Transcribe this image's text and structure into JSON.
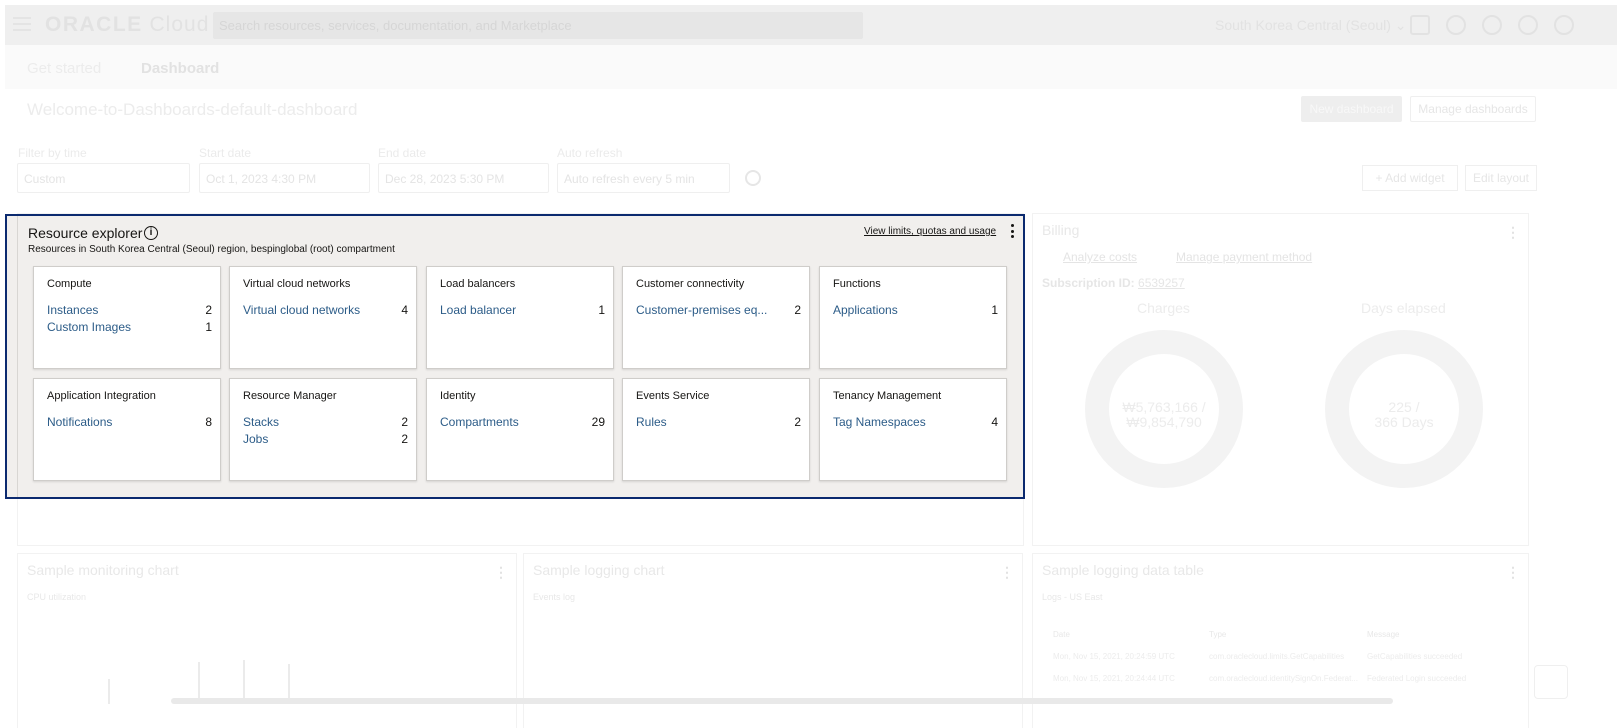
{
  "topbar": {
    "logo": "ORACLE",
    "logo_suffix": "Cloud",
    "search_placeholder": "Search resources, services, documentation, and Marketplace",
    "region": "South Korea Central (Seoul)"
  },
  "tabs": [
    {
      "label": "Get started"
    },
    {
      "label": "Dashboard"
    }
  ],
  "page_title": "Welcome-to-Dashboards-default-dashboard",
  "buttons": {
    "new_dashboard": "New dashboard",
    "manage_dashboards": "Manage dashboards",
    "add_widget": "+ Add widget",
    "edit_layout": "Edit layout"
  },
  "filters": {
    "filter_label": "Filter by time",
    "filter_value": "Custom",
    "start_label": "Start date",
    "start_value": "Oct 1, 2023 4:30 PM",
    "end_label": "End date",
    "end_value": "Dec 28, 2023 5:30 PM",
    "refresh_label": "Auto refresh",
    "refresh_value": "Auto refresh every 5 min"
  },
  "resource_explorer": {
    "title": "Resource explorer",
    "subtitle": "Resources in South Korea Central (Seoul) region, bespinglobal (root) compartment",
    "link": "View limits, quotas and usage",
    "cards": [
      {
        "title": "Compute",
        "rows": [
          {
            "label": "Instances",
            "count": "2"
          },
          {
            "label": "Custom Images",
            "count": "1"
          }
        ]
      },
      {
        "title": "Virtual cloud networks",
        "rows": [
          {
            "label": "Virtual cloud networks",
            "count": "4"
          }
        ]
      },
      {
        "title": "Load balancers",
        "rows": [
          {
            "label": "Load balancer",
            "count": "1"
          }
        ]
      },
      {
        "title": "Customer connectivity",
        "rows": [
          {
            "label": "Customer-premises eq...",
            "count": "2"
          }
        ]
      },
      {
        "title": "Functions",
        "rows": [
          {
            "label": "Applications",
            "count": "1"
          }
        ]
      },
      {
        "title": "Application Integration",
        "rows": [
          {
            "label": "Notifications",
            "count": "8"
          }
        ]
      },
      {
        "title": "Resource Manager",
        "rows": [
          {
            "label": "Stacks",
            "count": "2"
          },
          {
            "label": "Jobs",
            "count": "2"
          }
        ]
      },
      {
        "title": "Identity",
        "rows": [
          {
            "label": "Compartments",
            "count": "29"
          }
        ]
      },
      {
        "title": "Events Service",
        "rows": [
          {
            "label": "Rules",
            "count": "2"
          }
        ]
      },
      {
        "title": "Tenancy Management",
        "rows": [
          {
            "label": "Tag Namespaces",
            "count": "4"
          }
        ]
      }
    ]
  },
  "billing": {
    "title": "Billing",
    "analyze_costs": "Analyze costs",
    "manage_payment": "Manage payment method",
    "subscription_label": "Subscription ID:",
    "subscription_id": "6539257",
    "charges_label": "Charges",
    "charges_value": "₩5,763,166 /",
    "charges_total": "₩9,854,790",
    "days_label": "Days elapsed",
    "days_value": "225 /",
    "days_total": "366 Days"
  },
  "bottom_widgets": {
    "monitoring_title": "Sample monitoring chart",
    "monitoring_metric": "CPU utilization",
    "logging_chart_title": "Sample logging chart",
    "logging_chart_metric": "Events log",
    "logging_table_title": "Sample logging data table",
    "logging_table_metric": "Logs - US East",
    "table_headers": [
      "Date",
      "Type",
      "Message"
    ],
    "table_rows": [
      [
        "Mon, Nov 15, 2021, 20:24:59 UTC",
        "com.oraclecloud.limits.GetCapabilities",
        "GetCapabilities succeeded"
      ],
      [
        "Mon, Nov 15, 2021, 20:24:44 UTC",
        "com.oraclecloud.identitySignOn.Federat...",
        "Federated Login succeeded"
      ]
    ]
  }
}
